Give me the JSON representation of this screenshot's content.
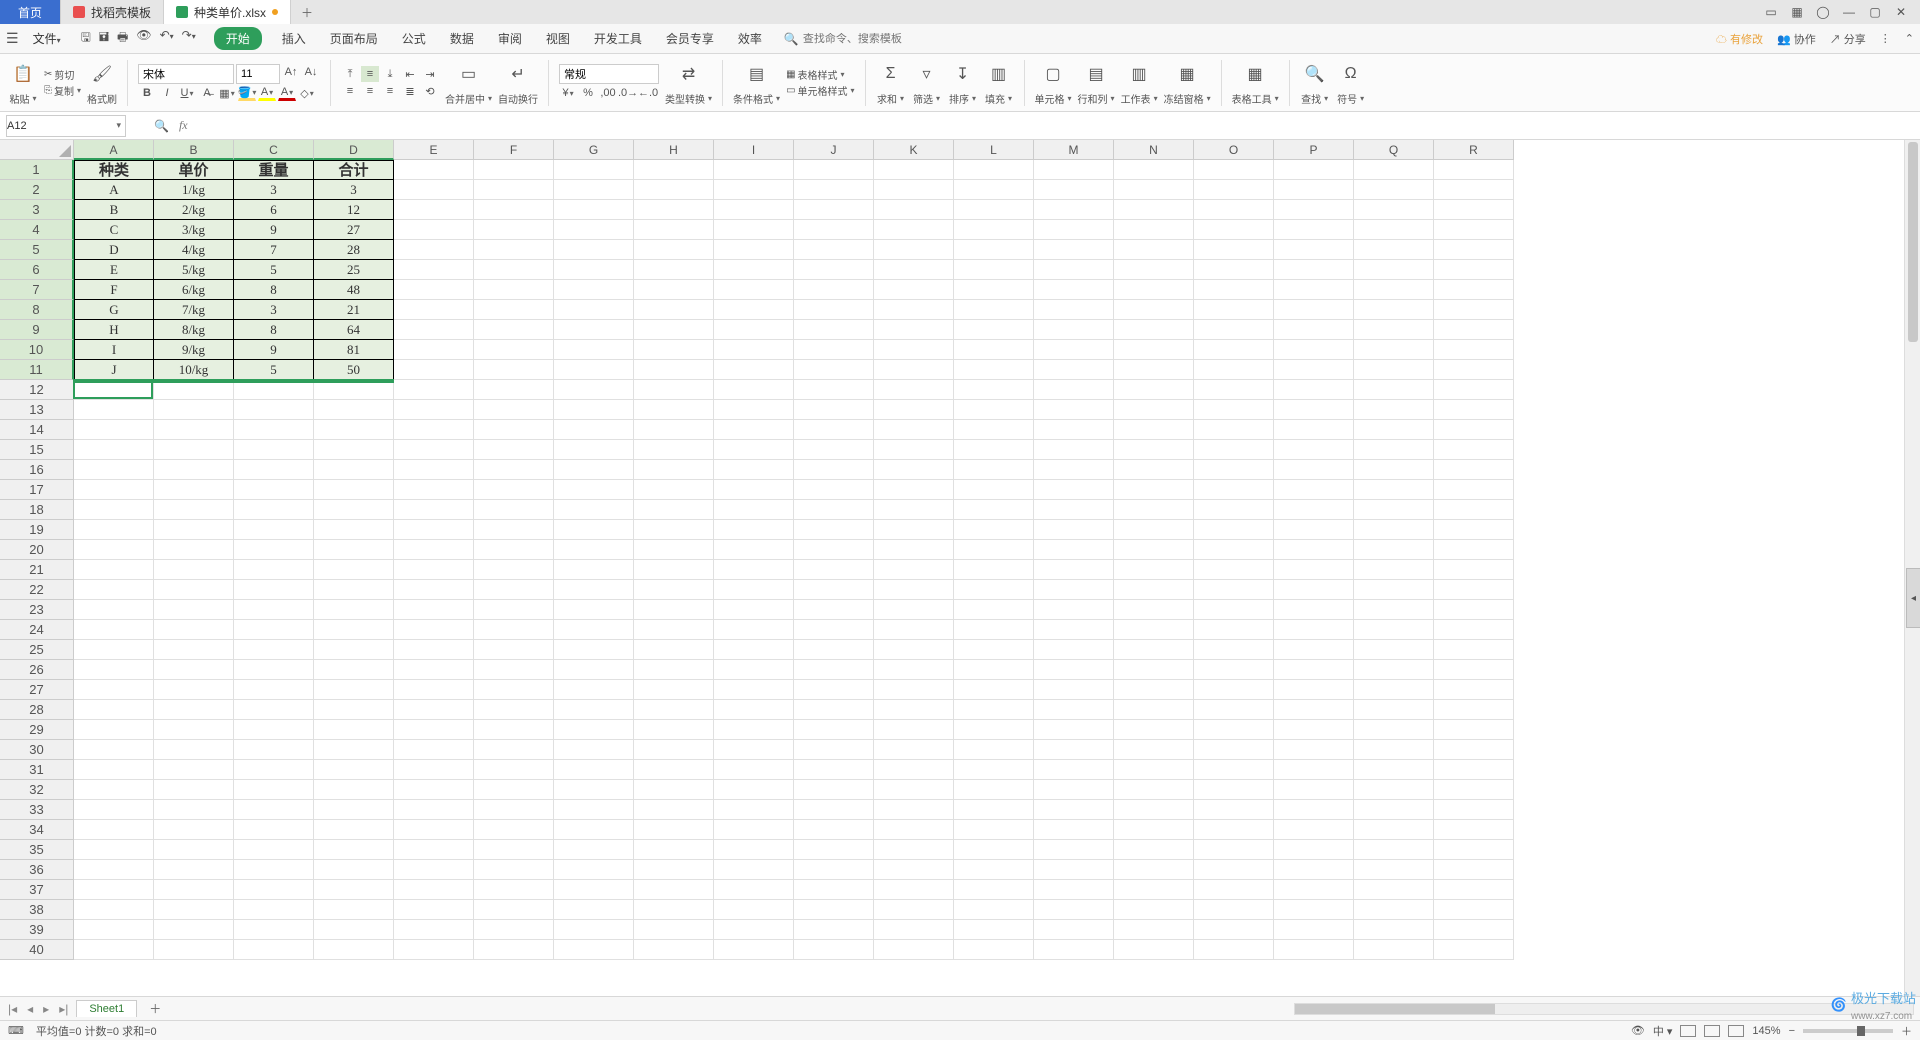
{
  "tabs": {
    "home": "首页",
    "templates": "找稻壳模板",
    "file": "种类单价.xlsx"
  },
  "menu": {
    "file": "文件",
    "items": [
      "开始",
      "插入",
      "页面布局",
      "公式",
      "数据",
      "审阅",
      "视图",
      "开发工具",
      "会员专享",
      "效率"
    ],
    "search_placeholder": "查找命令、搜索模板",
    "right": {
      "changes": "有修改",
      "collab": "协作",
      "share": "分享"
    }
  },
  "ribbon": {
    "paste": "粘贴",
    "cut": "剪切",
    "copy": "复制",
    "format_painter": "格式刷",
    "font_name": "宋体",
    "font_size": "11",
    "merge": "合并居中",
    "wrap": "自动换行",
    "number_format": "常规",
    "type_convert": "类型转换",
    "cond_format": "条件格式",
    "table_style": "表格样式",
    "cell_style": "单元格样式",
    "sum": "求和",
    "filter": "筛选",
    "sort": "排序",
    "fill": "填充",
    "cell": "单元格",
    "rowcol": "行和列",
    "worksheet": "工作表",
    "freeze": "冻结窗格",
    "table_tools": "表格工具",
    "find": "查找",
    "symbol": "符号"
  },
  "namebox": "A12",
  "grid": {
    "col_headers": [
      "A",
      "B",
      "C",
      "D"
    ],
    "row_headers": [
      "1",
      "2",
      "3",
      "4",
      "5",
      "6",
      "7",
      "8",
      "9",
      "10",
      "11"
    ],
    "header_row": [
      "种类",
      "单价",
      "重量",
      "合计"
    ],
    "rows": [
      [
        "A",
        "1/kg",
        "3",
        "3"
      ],
      [
        "B",
        "2/kg",
        "6",
        "12"
      ],
      [
        "C",
        "3/kg",
        "9",
        "27"
      ],
      [
        "D",
        "4/kg",
        "7",
        "28"
      ],
      [
        "E",
        "5/kg",
        "5",
        "25"
      ],
      [
        "F",
        "6/kg",
        "8",
        "48"
      ],
      [
        "G",
        "7/kg",
        "3",
        "21"
      ],
      [
        "H",
        "8/kg",
        "8",
        "64"
      ],
      [
        "I",
        "9/kg",
        "9",
        "81"
      ],
      [
        "J",
        "10/kg",
        "5",
        "50"
      ]
    ]
  },
  "sheet": {
    "name": "Sheet1"
  },
  "status": {
    "stats": "平均值=0  计数=0  求和=0",
    "zoom": "145%"
  },
  "watermark": {
    "main": "极光下载站",
    "sub": "www.xz7.com"
  }
}
